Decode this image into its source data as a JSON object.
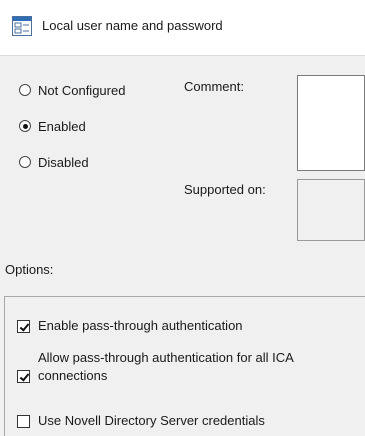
{
  "header": {
    "title": "Local user name and password",
    "icon": "policy-setting-icon"
  },
  "state_options": [
    {
      "label": "Not Configured",
      "selected": false
    },
    {
      "label": "Enabled",
      "selected": true
    },
    {
      "label": "Disabled",
      "selected": false
    }
  ],
  "comment": {
    "label": "Comment:",
    "value": ""
  },
  "supported_on": {
    "label": "Supported on:",
    "value": ""
  },
  "options": {
    "label": "Options:",
    "items": [
      {
        "label": "Enable pass-through authentication",
        "checked": true
      },
      {
        "label_line1": "Allow pass-through authentication for all ICA",
        "label_line2": "connections",
        "checked": true
      },
      {
        "label": "Use Novell Directory Server credentials",
        "checked": false
      }
    ]
  },
  "colors": {
    "header_bg": "#ffffff",
    "window_bg": "#f0f0f0",
    "icon_blue": "#2f6db5"
  }
}
